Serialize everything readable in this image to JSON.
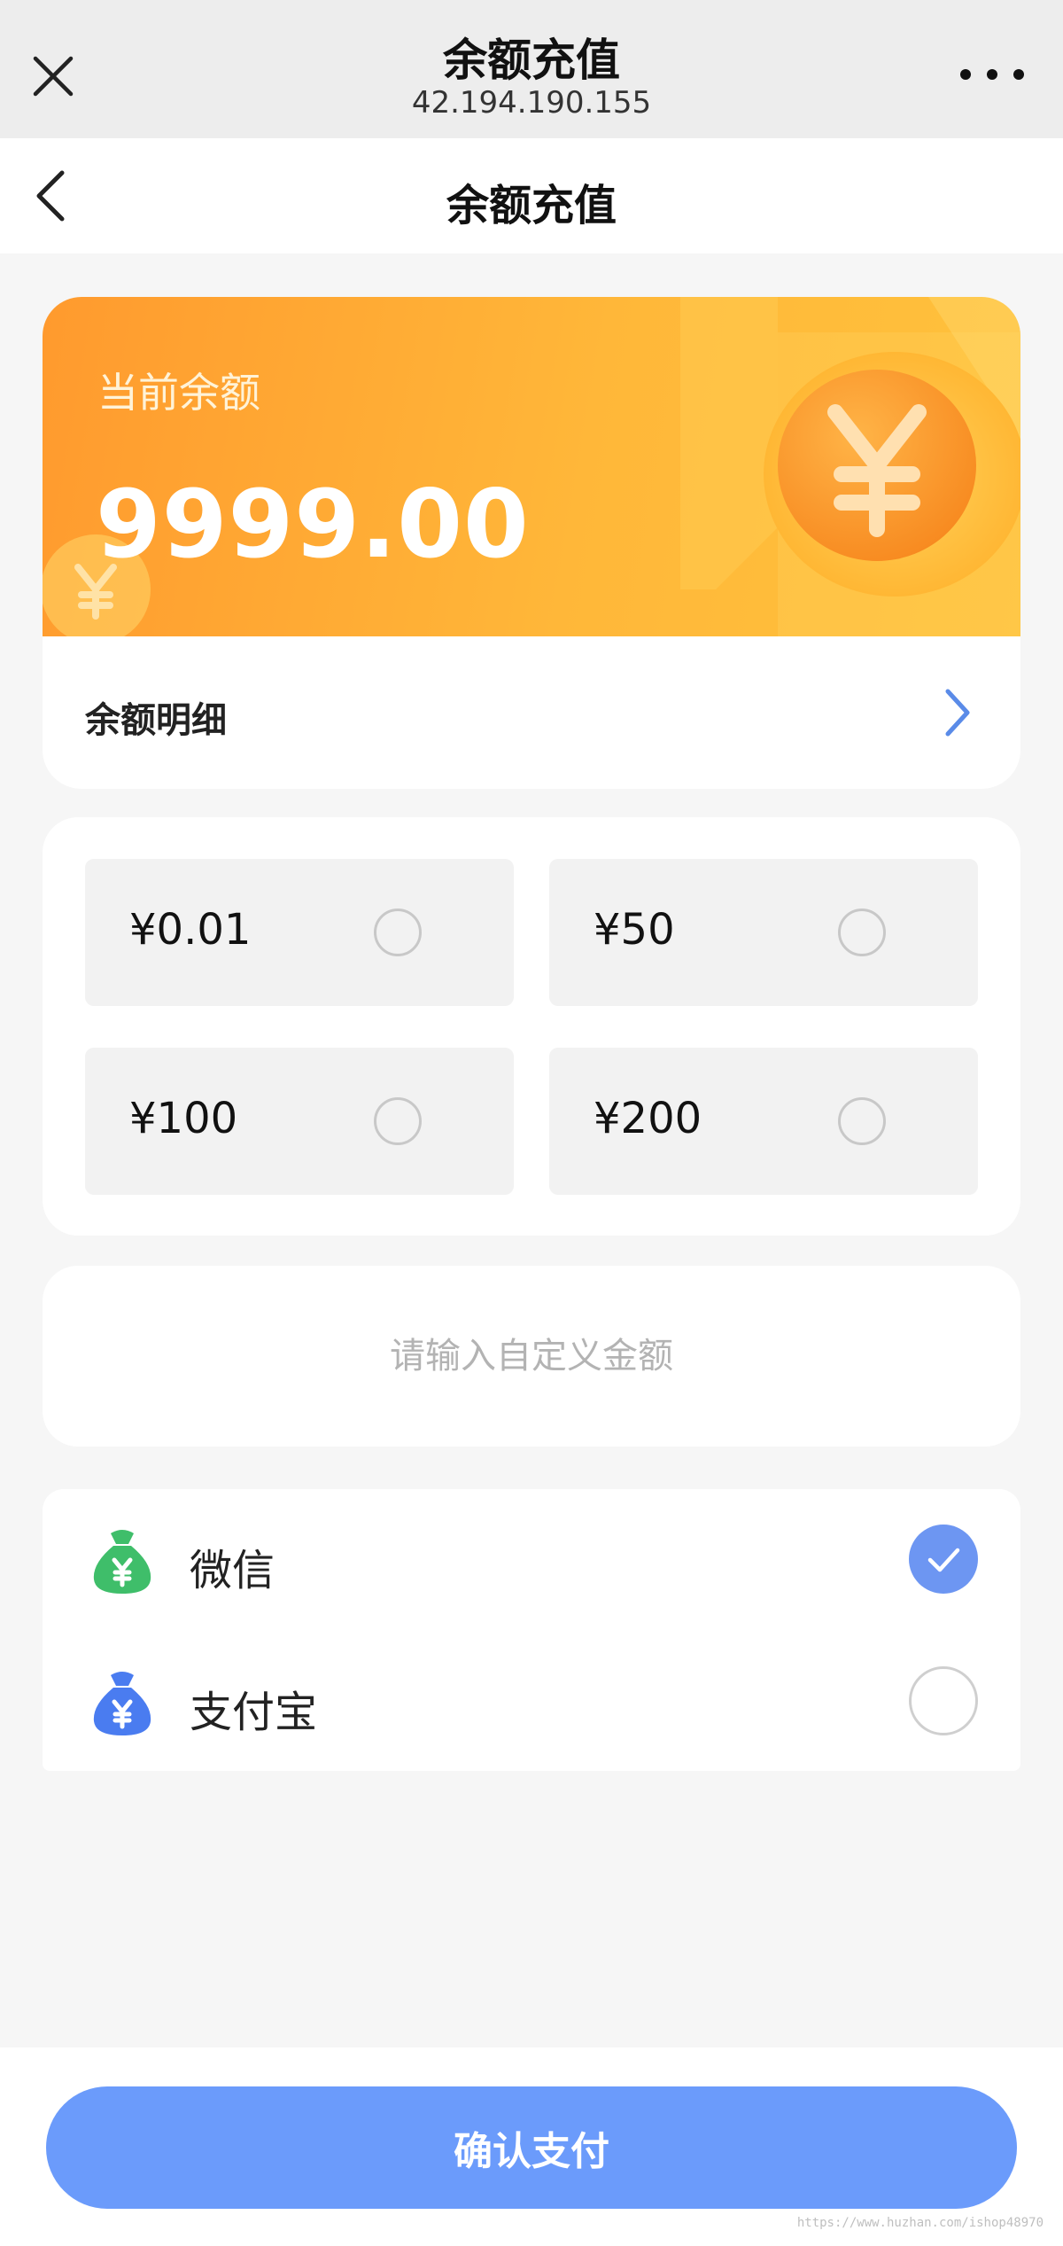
{
  "browser": {
    "title": "余额充值",
    "url": "42.194.190.155"
  },
  "nav": {
    "title": "余额充值"
  },
  "balance": {
    "label": "当前余额",
    "amount": "9999.00",
    "detail_label": "余额明细"
  },
  "amount_options": [
    {
      "label": "¥0.01",
      "selected": false
    },
    {
      "label": "¥50",
      "selected": false
    },
    {
      "label": "¥100",
      "selected": false
    },
    {
      "label": "¥200",
      "selected": false
    }
  ],
  "custom_amount": {
    "placeholder": "请输入自定义金额",
    "value": ""
  },
  "payment_methods": [
    {
      "label": "微信",
      "icon": "wechat-money-bag-icon",
      "color": "#3fbe6a",
      "selected": true
    },
    {
      "label": "支付宝",
      "icon": "alipay-money-bag-icon",
      "color": "#4a7cf0",
      "selected": false
    }
  ],
  "confirm": {
    "label": "确认支付"
  },
  "colors": {
    "accent": "#6b9bfb",
    "banner_start": "#ff9a2e",
    "banner_end": "#ffc23c"
  },
  "watermark": "https://www.huzhan.com/ishop48970"
}
